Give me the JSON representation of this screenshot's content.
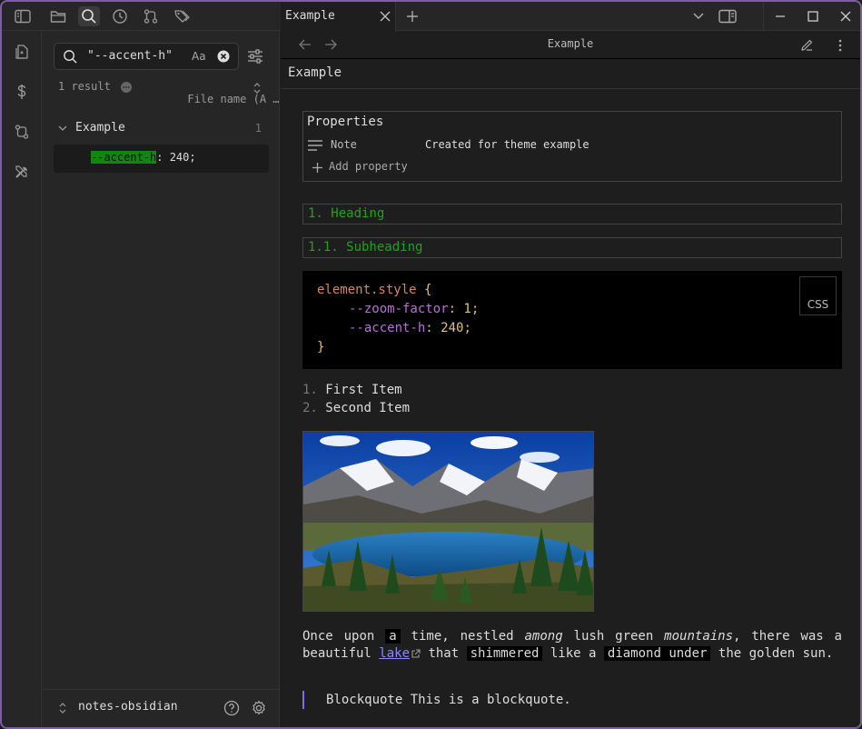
{
  "top_bar": {
    "tab_title": "Example",
    "window_controls": [
      "minimize-icon",
      "maximize-icon",
      "close-icon"
    ]
  },
  "ribbon": {
    "icons": [
      "files-icon",
      "dollar-icon",
      "git-compare-icon",
      "tools-icon"
    ]
  },
  "search": {
    "query": "\"--accent-h\"",
    "match_case_label": "Aa",
    "result_count": "1 result",
    "sort_label": "File name (A …",
    "group_label": "Example",
    "group_count": "1",
    "match_highlight": "--accent-h",
    "match_rest": ": 240;"
  },
  "vault": {
    "name": "notes-obsidian"
  },
  "main": {
    "nav_title": "Example",
    "inline_title": "Example",
    "properties": {
      "heading": "Properties",
      "key": "Note",
      "value": "Created for theme example",
      "add_label": "Add property"
    },
    "heading1": "1. Heading",
    "heading2": "1.1. Subheading",
    "code": {
      "lang": "CSS",
      "selector": "element.style",
      "open_brace": " {",
      "line1_prop": "--zoom-factor",
      "line1_val": ": 1;",
      "line2_prop": "--accent-h",
      "line2_val": ": 240;",
      "close_brace": "}"
    },
    "list": [
      {
        "num": "1.",
        "text": "First Item"
      },
      {
        "num": "2.",
        "text": "Second Item"
      }
    ],
    "paragraph": {
      "p1": "Once upon ",
      "m1": "a",
      "p2": " time, nestled ",
      "em1": "among",
      "p3": " lush green ",
      "em2": "mountains",
      "p4": ", there was a beautiful ",
      "link": "lake",
      "p5": " that ",
      "m2": "shimmered",
      "p6": " like a ",
      "m3": "diamond under",
      "p7": " the golden sun."
    },
    "blockquote": "Blockquote This is a blockquote."
  },
  "colors": {
    "accent": "#7b5ea7",
    "heading_green": "#1ea31b",
    "highlight_green": "#12860f",
    "link": "#8a8aff"
  }
}
